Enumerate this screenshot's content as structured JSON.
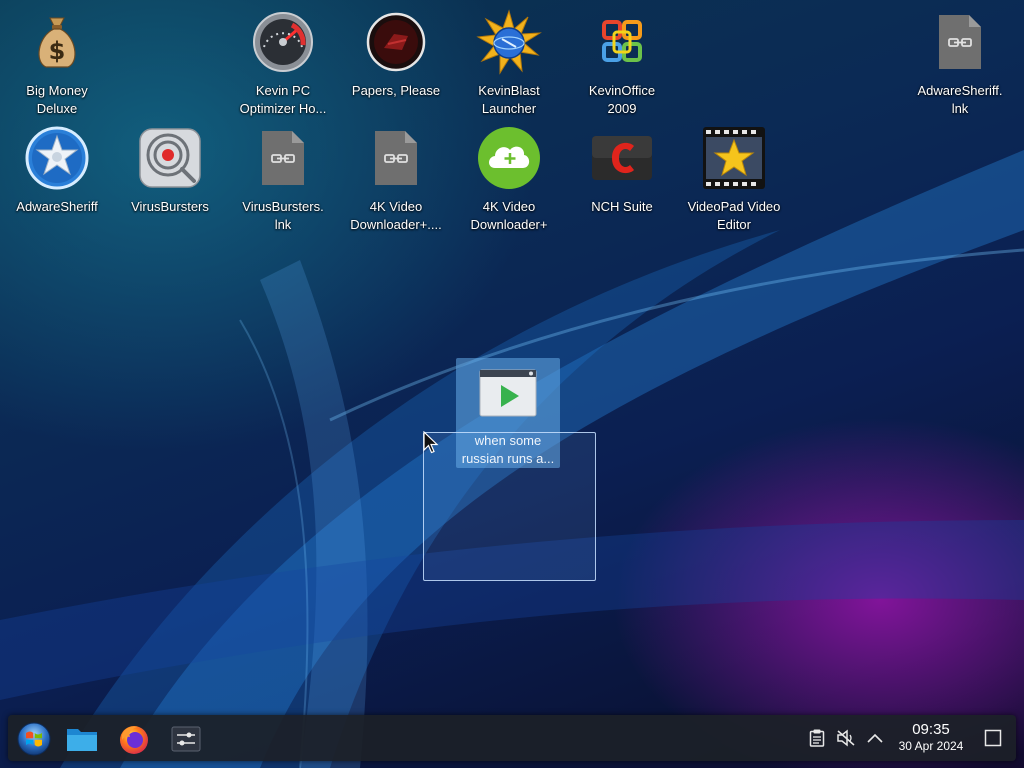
{
  "desktop": {
    "icons": [
      {
        "label": "Big Money\nDeluxe",
        "icon": "money-bag-icon"
      },
      {
        "label": "Kevin PC\nOptimizer Ho...",
        "icon": "speedometer-icon"
      },
      {
        "label": "Papers, Please",
        "icon": "papers-please-icon"
      },
      {
        "label": "KevinBlast\nLauncher",
        "icon": "kevinblast-sun-icon"
      },
      {
        "label": "KevinOffice\n2009",
        "icon": "office-logo-icon"
      },
      {
        "label": "AdwareSheriff.\nlnk",
        "icon": "link-file-icon"
      },
      {
        "label": "AdwareSheriff",
        "icon": "sheriff-badge-icon"
      },
      {
        "label": "VirusBursters",
        "icon": "virus-target-icon"
      },
      {
        "label": "VirusBursters.\nlnk",
        "icon": "link-file-icon"
      },
      {
        "label": "4K Video\nDownloader+....",
        "icon": "link-file-icon"
      },
      {
        "label": "4K Video\nDownloader+",
        "icon": "cloud-download-icon"
      },
      {
        "label": "NCH Suite",
        "icon": "nch-suite-icon"
      },
      {
        "label": "VideoPad Video\nEditor",
        "icon": "film-star-icon"
      },
      {
        "label": "when some\nrussian runs a...",
        "icon": "video-play-icon"
      }
    ]
  },
  "taskbar": {
    "start": {
      "icon": "start-orb-icon"
    },
    "pinned": [
      {
        "icon": "file-manager-icon"
      },
      {
        "icon": "firefox-icon"
      },
      {
        "icon": "settings-sliders-icon"
      }
    ],
    "tray": {
      "icons": [
        "clipboard-icon",
        "speaker-muted-icon",
        "chevron-up-icon"
      ],
      "time": "09:35",
      "date": "30 Apr 2024",
      "show_desktop_icon": "show-desktop-icon"
    }
  },
  "colors": {
    "taskbar": "#1c2028",
    "selection": "#64aae6",
    "wallpaper_purple": "#9614aa",
    "wallpaper_blue": "#0b2a55"
  }
}
